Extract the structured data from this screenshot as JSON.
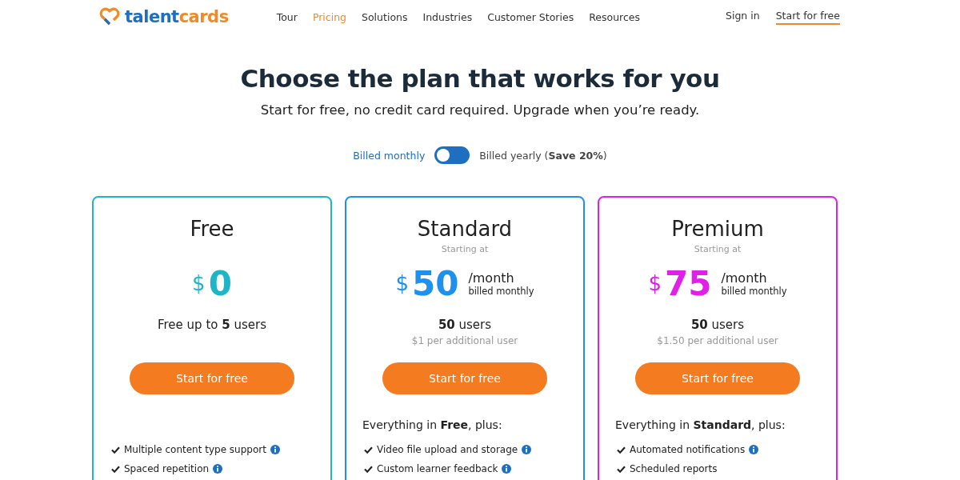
{
  "brand": {
    "name_part1": "talent",
    "name_part2": "cards"
  },
  "nav": [
    {
      "label": "Tour",
      "selected": false
    },
    {
      "label": "Pricing",
      "selected": true
    },
    {
      "label": "Solutions",
      "selected": false
    },
    {
      "label": "Industries",
      "selected": false
    },
    {
      "label": "Customer Stories",
      "selected": false
    },
    {
      "label": "Resources",
      "selected": false
    }
  ],
  "header_actions": {
    "sign_in": "Sign in",
    "start": "Start for free"
  },
  "title": "Choose the plan that works for you",
  "subtitle": "Start for free, no credit card required. Upgrade when you’re ready.",
  "billing": {
    "monthly_label": "Billed monthly",
    "yearly_label": "Billed yearly (**Save 20%**)",
    "on": false
  },
  "plans": [
    {
      "name": "Free",
      "color": "#1fb5c9",
      "currency": "$",
      "amount": "0",
      "users": "Free up to **5** users",
      "button": "Start for free",
      "features": [
        {
          "text": "Multiple content type support",
          "info": true
        },
        {
          "text": "Spaced repetition",
          "info": true
        }
      ]
    },
    {
      "name": "Standard",
      "color": "#1e90ee",
      "starting": "Starting at",
      "currency": "$",
      "amount": "50",
      "period": "/month",
      "billed": "billed monthly",
      "users": "**50** users",
      "extra": "$1 per additional user",
      "button": "Start for free",
      "intro": "Everything in **Free**, plus:",
      "features": [
        {
          "text": "Video file upload and storage",
          "info": true
        },
        {
          "text": "Custom learner feedback",
          "info": true
        }
      ]
    },
    {
      "name": "Premium",
      "color": "#e020e8",
      "starting": "Starting at",
      "currency": "$",
      "amount": "75",
      "period": "/month",
      "billed": "billed monthly",
      "users": "**50** users",
      "extra": "$1.50 per additional user",
      "button": "Start for free",
      "intro": "Everything in **Standard**, plus:",
      "features": [
        {
          "text": "Automated notifications",
          "info": true
        },
        {
          "text": "Scheduled reports",
          "info": false
        }
      ]
    }
  ]
}
